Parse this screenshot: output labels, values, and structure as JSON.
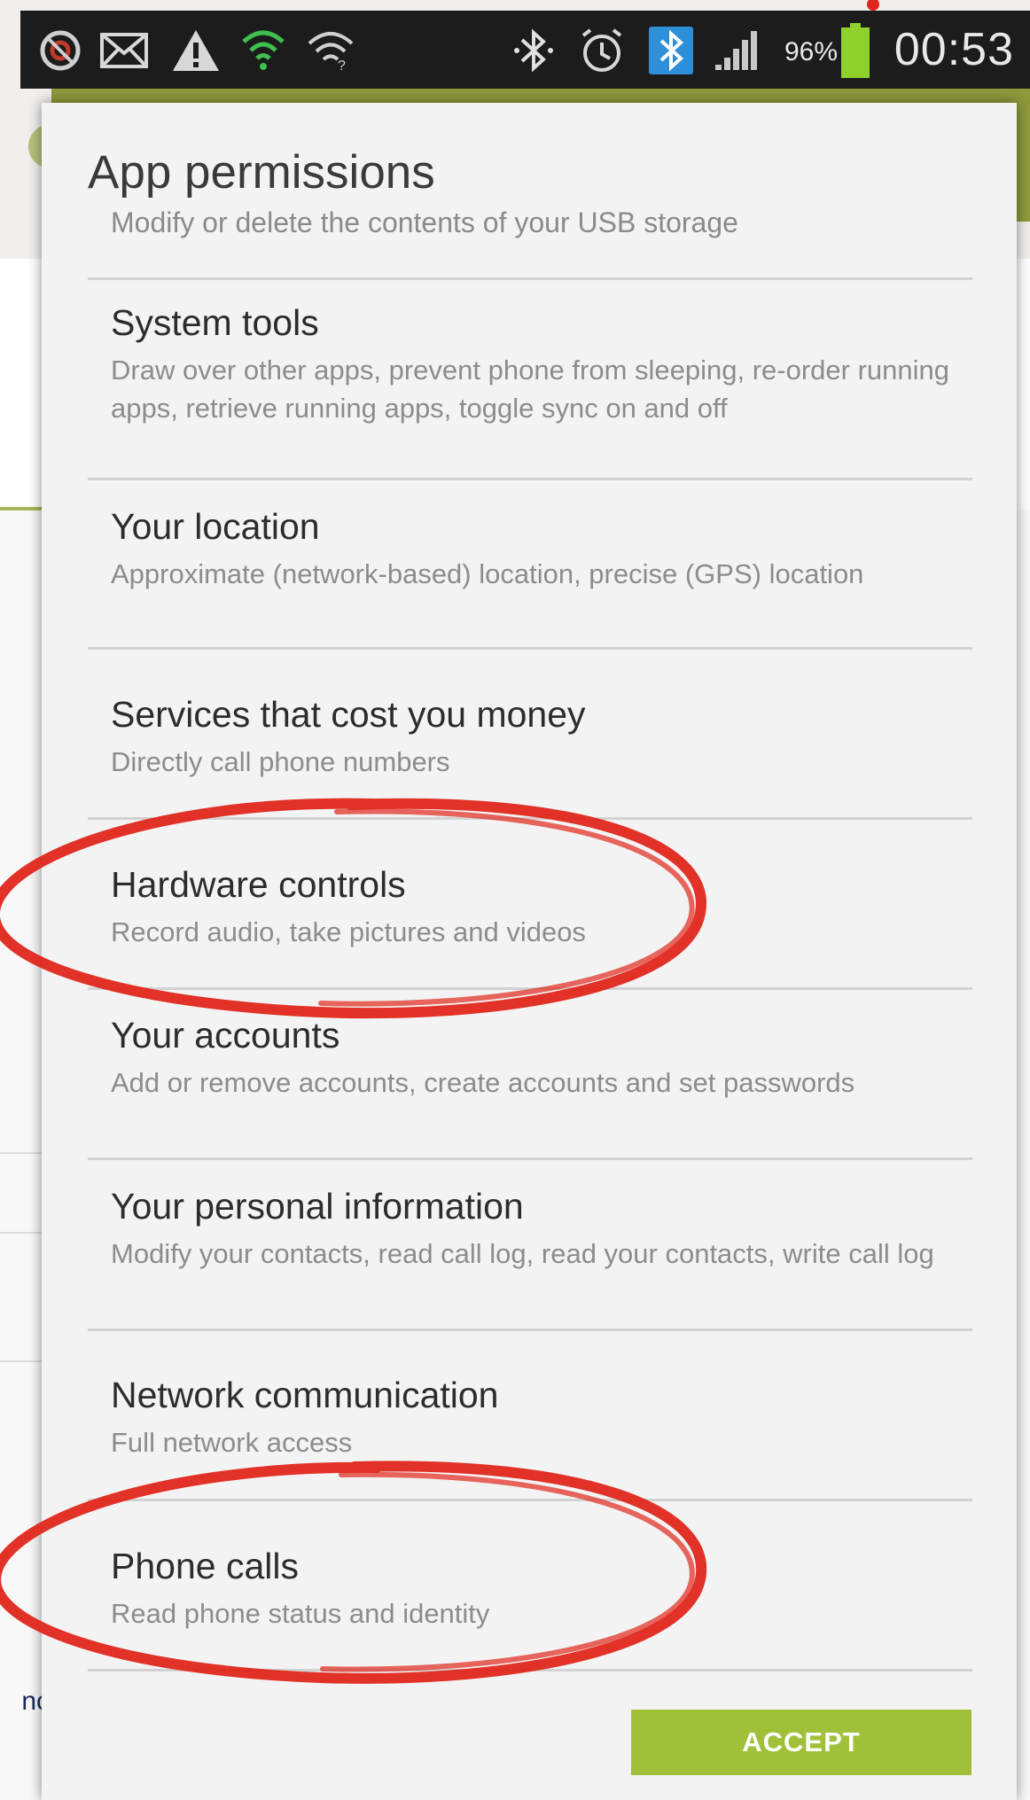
{
  "status_bar": {
    "battery_percent": "96%",
    "time": "00:53",
    "icons": [
      "app-notification-icon",
      "mail-icon",
      "warning-icon",
      "wifi-icon",
      "wifi-hotspot-icon",
      "bluetooth-icon",
      "alarm-icon",
      "bluetooth-active-icon",
      "signal-icon",
      "battery-icon"
    ]
  },
  "background": {
    "snippet": "nc"
  },
  "dialog": {
    "title": "App permissions",
    "subtitle": "Modify or delete the contents of your USB storage",
    "permissions": [
      {
        "title": "System tools",
        "desc": "Draw over other apps, prevent phone from sleeping, re-order running apps, retrieve running apps, toggle sync on and off"
      },
      {
        "title": "Your location",
        "desc": "Approximate (network-based) location, precise (GPS) location"
      },
      {
        "title": "Services that cost you money",
        "desc": "Directly call phone numbers"
      },
      {
        "title": "Hardware controls",
        "desc": "Record audio, take pictures and videos"
      },
      {
        "title": "Your accounts",
        "desc": "Add or remove accounts, create accounts and set passwords"
      },
      {
        "title": "Your personal information",
        "desc": "Modify your contacts, read call log, read your contacts, write call log"
      },
      {
        "title": "Network communication",
        "desc": "Full network access"
      },
      {
        "title": "Phone calls",
        "desc": "Read phone status and identity"
      }
    ],
    "accept_label": "ACCEPT"
  },
  "colors": {
    "accent": "#9fc038",
    "annotation": "#e0261b",
    "status_bar": "#1c1c1c"
  }
}
